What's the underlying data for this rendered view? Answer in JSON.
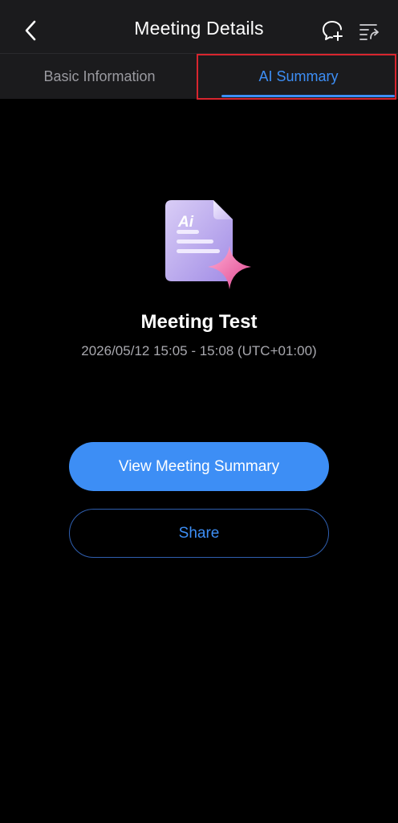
{
  "header": {
    "title": "Meeting Details",
    "back_icon": "chevron-left-icon",
    "icons": [
      "add-chat-icon",
      "share-list-icon"
    ]
  },
  "tabs": [
    {
      "label": "Basic Information",
      "active": false
    },
    {
      "label": "AI Summary",
      "active": true
    }
  ],
  "summary": {
    "doc_icon_label": "Ai",
    "meeting_title": "Meeting Test",
    "meeting_time": "2026/05/12 15:05 - 15:08 (UTC+01:00)"
  },
  "actions": {
    "view_label": "View Meeting Summary",
    "share_label": "Share"
  },
  "colors": {
    "accent": "#3d8ef5",
    "background": "#000000",
    "header_bg": "#1b1b1d",
    "highlight": "#d8252e"
  }
}
